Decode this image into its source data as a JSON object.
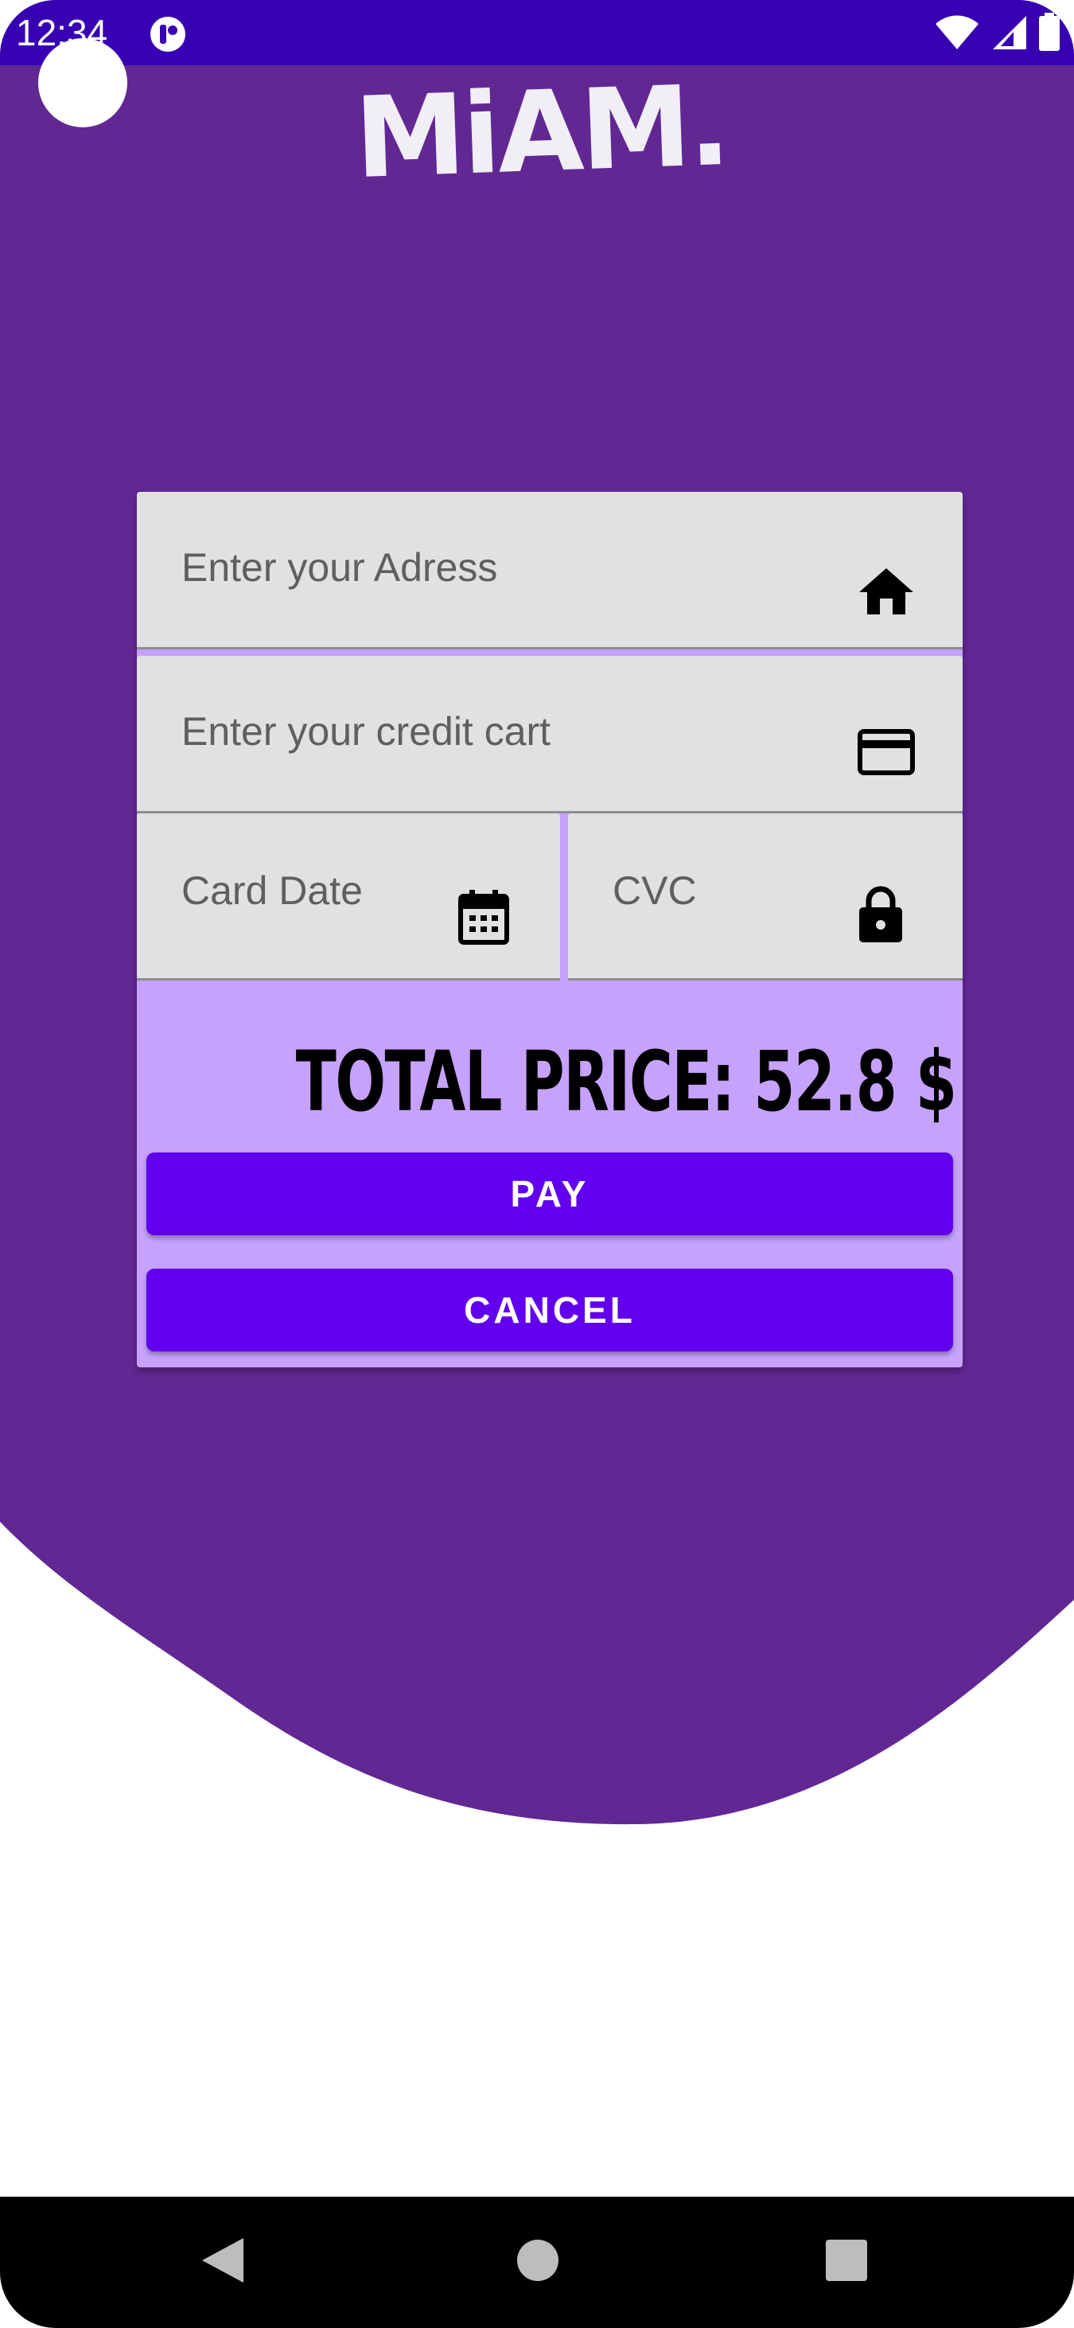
{
  "status_bar": {
    "time": "12:34"
  },
  "logo": {
    "text": "MiAM."
  },
  "form": {
    "address": {
      "placeholder": "Enter your Adress",
      "icon": "home-icon"
    },
    "credit_card": {
      "placeholder": "Enter your credit cart",
      "icon": "credit-card-icon"
    },
    "card_date": {
      "placeholder": "Card Date",
      "icon": "calendar-icon"
    },
    "cvc": {
      "placeholder": "CVC",
      "icon": "lock-icon"
    }
  },
  "total": {
    "label": "TOTAL PRICE: 52.8 $"
  },
  "buttons": {
    "pay": "PAY",
    "cancel": "CANCEL"
  },
  "colors": {
    "status_bar": "#3700b3",
    "background_purple": "#612893",
    "card": "#c6a2fd",
    "button": "#6200ee",
    "field": "#e1e1e1"
  },
  "nav": {
    "back_icon": "back-triangle-icon",
    "home_icon": "home-circle-icon",
    "recents_icon": "recents-square-icon"
  }
}
